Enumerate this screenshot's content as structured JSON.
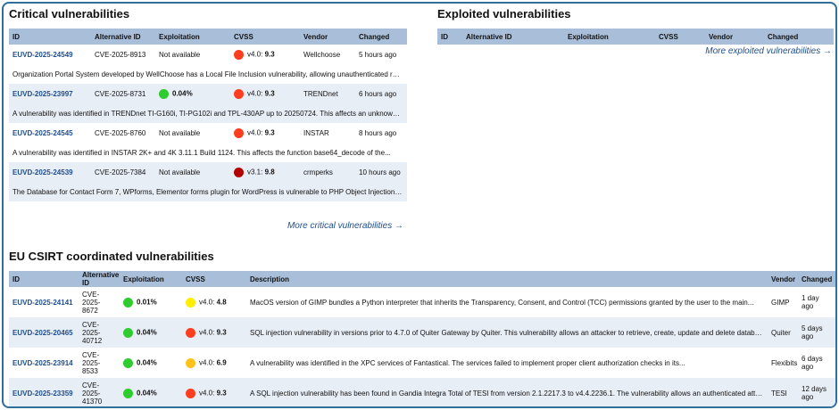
{
  "critical": {
    "title": "Critical vulnerabilities",
    "headers": [
      "ID",
      "Alternative ID",
      "Exploitation",
      "CVSS",
      "Vendor",
      "Changed"
    ],
    "rows": [
      {
        "id": "EUVD-2025-24549",
        "alt_id": "CVE-2025-8913",
        "exploitation": "Not available",
        "expl_color": "",
        "cvss_color": "#ff3d1f",
        "cvss_version": "v4.0:",
        "cvss_score": "9.3",
        "vendor": "Wellchoose",
        "changed": "5 hours ago",
        "description": "Organization Portal System developed by WellChoose has a Local File Inclusion vulnerability, allowing unauthenticated remot..."
      },
      {
        "id": "EUVD-2025-23997",
        "alt_id": "CVE-2025-8731",
        "exploitation": "0.04%",
        "expl_color": "#2ecc2e",
        "cvss_color": "#ff3d1f",
        "cvss_version": "v4.0:",
        "cvss_score": "9.3",
        "vendor": "TRENDnet",
        "changed": "6 hours ago",
        "description": "A vulnerability was identified in TRENDnet TI-G160i, TI-PG102i and TPL-430AP up to 20250724. This affects an unknown pa..."
      },
      {
        "id": "EUVD-2025-24545",
        "alt_id": "CVE-2025-8760",
        "exploitation": "Not available",
        "expl_color": "",
        "cvss_color": "#ff3d1f",
        "cvss_version": "v4.0:",
        "cvss_score": "9.3",
        "vendor": "INSTAR",
        "changed": "8 hours ago",
        "description": "A vulnerability was identified in INSTAR 2K+ and 4K 3.11.1 Build 1124. This affects the function base64_decode of the..."
      },
      {
        "id": "EUVD-2025-24539",
        "alt_id": "CVE-2025-7384",
        "exploitation": "Not available",
        "expl_color": "",
        "cvss_color": "#b30000",
        "cvss_version": "v3.1:",
        "cvss_score": "9.8",
        "vendor": "crmperks",
        "changed": "10 hours ago",
        "description": "The Database for Contact Form 7, WPforms, Elementor forms plugin for WordPress is vulnerable to PHP Object Injection in a..."
      }
    ],
    "more_link": "More critical vulnerabilities →"
  },
  "exploited": {
    "title": "Exploited vulnerabilities",
    "headers": [
      "ID",
      "Alternative ID",
      "Exploitation",
      "CVSS",
      "Vendor",
      "Changed"
    ],
    "more_link": "More exploited vulnerabilities →"
  },
  "eu_csirt": {
    "title": "EU CSIRT coordinated vulnerabilities",
    "headers": [
      "ID",
      "Alternative ID",
      "Exploitation",
      "CVSS",
      "Description",
      "Vendor",
      "Changed"
    ],
    "rows": [
      {
        "id": "EUVD-2025-24141",
        "alt_id": "CVE-2025-8672",
        "exploitation": "0.01%",
        "expl_color": "#2ecc2e",
        "cvss_color": "#ffee00",
        "cvss_version": "v4.0:",
        "cvss_score": "4.8",
        "description": "MacOS version of GIMP bundles a Python interpreter that inherits the Transparency, Consent, and Control (TCC) permissions granted by the user to the main...",
        "vendor": "GIMP",
        "changed": "1 day ago"
      },
      {
        "id": "EUVD-2025-20465",
        "alt_id": "CVE-2025-40712",
        "exploitation": "0.04%",
        "expl_color": "#2ecc2e",
        "cvss_color": "#ff3d1f",
        "cvss_version": "v4.0:",
        "cvss_score": "9.3",
        "description": "SQL injection vulnerability in versions prior to 4.7.0 of Quiter Gateway by Quiter. This vulnerability allows an attacker to retrieve, create, update and delete databases...",
        "vendor": "Quiter",
        "changed": "5 days ago"
      },
      {
        "id": "EUVD-2025-23914",
        "alt_id": "CVE-2025-8533",
        "exploitation": "0.04%",
        "expl_color": "#2ecc2e",
        "cvss_color": "#ffc21a",
        "cvss_version": "v4.0:",
        "cvss_score": "6.9",
        "description": "A vulnerability was identified in the XPC services of Fantastical. The services failed to implement proper client authorization checks in its...",
        "vendor": "Flexibits",
        "changed": "6 days ago"
      },
      {
        "id": "EUVD-2025-23359",
        "alt_id": "CVE-2025-41370",
        "exploitation": "0.04%",
        "expl_color": "#2ecc2e",
        "cvss_color": "#ff3d1f",
        "cvss_version": "v4.0:",
        "cvss_score": "9.3",
        "description": "A SQL injection vulnerability has been found in Gandia Integra Total of TESI from version 2.1.2217.3 to v4.4.2236.1. The vulnerability allows an authenticated attacker ...",
        "vendor": "TESI",
        "changed": "12 days ago"
      }
    ]
  }
}
